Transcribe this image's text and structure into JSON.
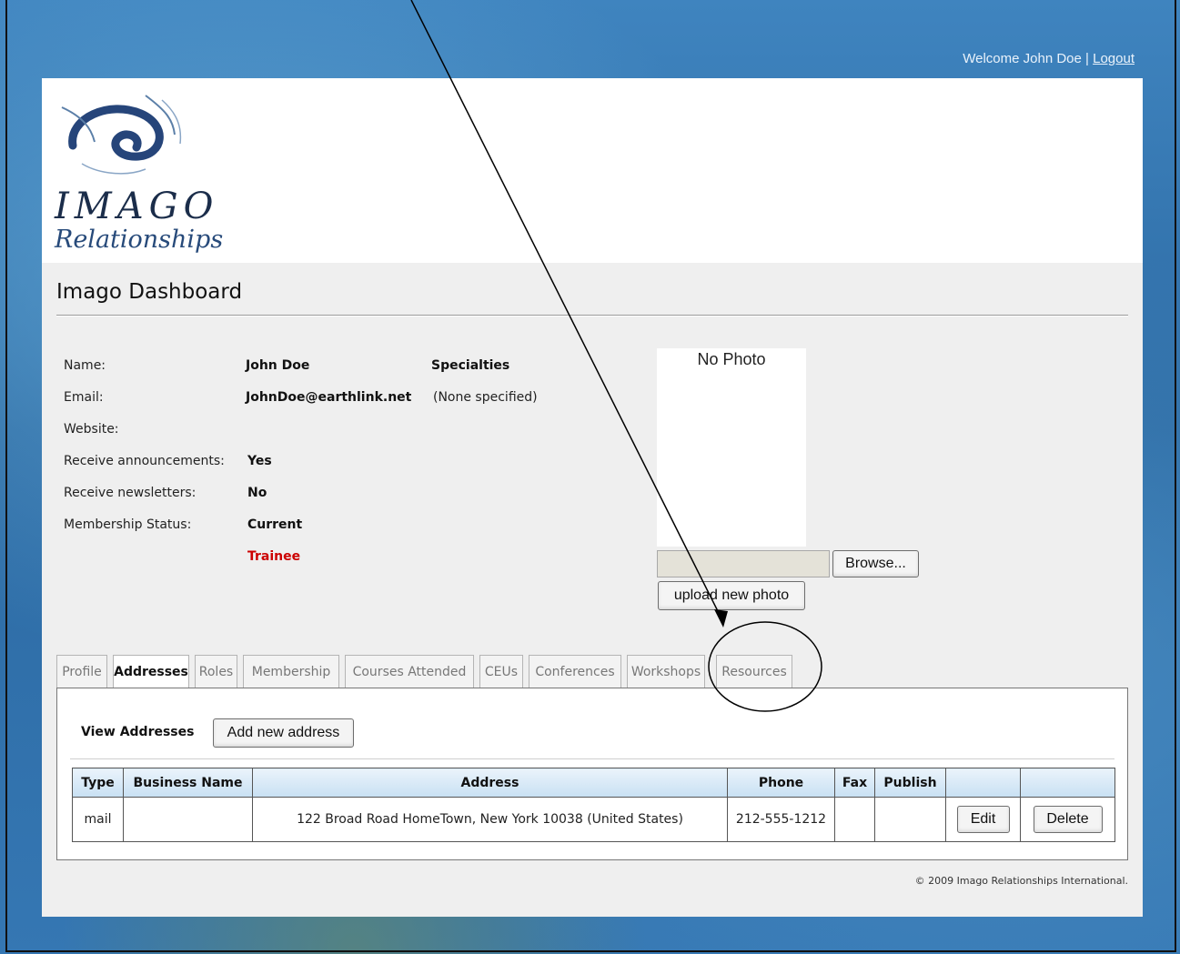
{
  "topbar": {
    "welcome_text": "Welcome John Doe | ",
    "logout_label": "Logout"
  },
  "logo": {
    "word": "IMAGO",
    "sub": "Relationships"
  },
  "page_title": "Imago Dashboard",
  "profile": {
    "name_label": "Name:",
    "name_value": "John Doe",
    "email_label": "Email:",
    "email_value": "JohnDoe@earthlink.net",
    "website_label": "Website:",
    "announce_label": "Receive announcements:",
    "announce_value": "Yes",
    "newsletter_label": "Receive newsletters:",
    "newsletter_value": "No",
    "status_label": "Membership Status:",
    "status_value": "Current",
    "status_extra": "Trainee",
    "specialties_label": "Specialties",
    "specialties_value": "(None specified)"
  },
  "photo": {
    "placeholder": "No Photo",
    "browse_label": "Browse...",
    "upload_label": "upload new photo"
  },
  "tabs": [
    "Profile",
    "Addresses",
    "Roles",
    "Membership",
    "Courses Attended",
    "CEUs",
    "Conferences",
    "Workshops",
    "Resources"
  ],
  "active_tab": "Addresses",
  "addresses": {
    "title": "View Addresses",
    "add_label": "Add new address",
    "columns": [
      "Type",
      "Business Name",
      "Address",
      "Phone",
      "Fax",
      "Publish",
      "",
      ""
    ],
    "rows": [
      {
        "type": "mail",
        "business": "",
        "address": "122 Broad Road HomeTown, New York 10038 (United States)",
        "phone": "212-555-1212",
        "fax": "",
        "publish": "",
        "edit": "Edit",
        "delete": "Delete"
      }
    ]
  },
  "footer": "© 2009 Imago Relationships International.",
  "colors": {
    "accent_red": "#cc0000",
    "header_blue": "#c8e0f3",
    "page_bg": "#efefef"
  }
}
